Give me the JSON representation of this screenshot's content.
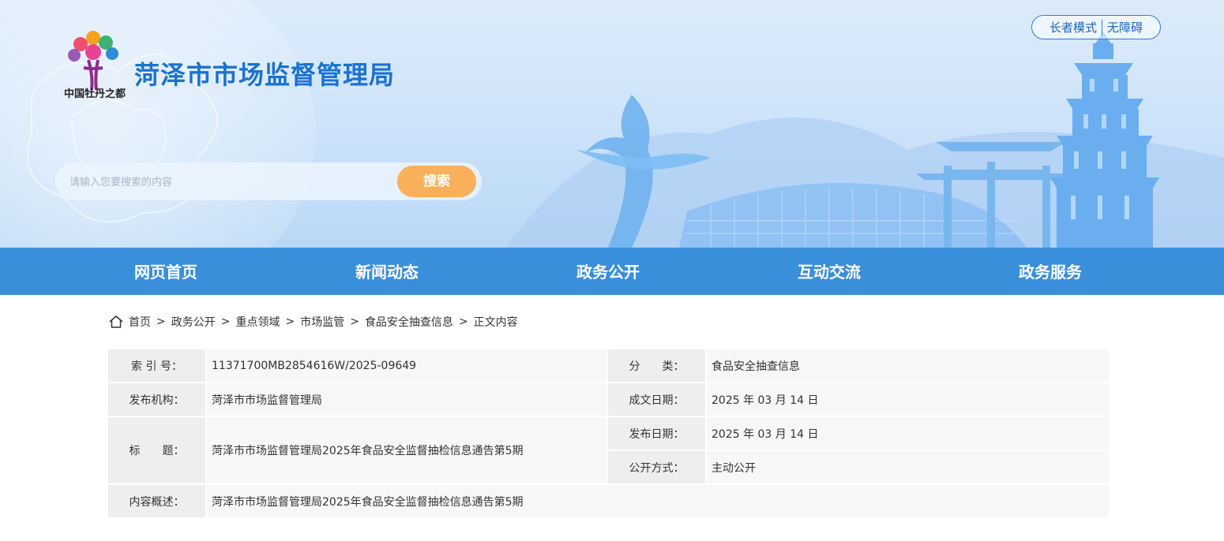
{
  "header": {
    "site_title": "菏泽市市场监督管理局",
    "logo_text": "中国牡丹之都",
    "elder_mode": "长者模式",
    "accessibility": "无障碍",
    "search_placeholder": "请输入您要搜索的内容",
    "search_button": "搜索"
  },
  "nav": [
    "网页首页",
    "新闻动态",
    "政务公开",
    "互动交流",
    "政务服务"
  ],
  "breadcrumb": {
    "items": [
      "首页",
      "政务公开",
      "重点领域",
      "市场监管",
      "食品安全抽查信息",
      "正文内容"
    ],
    "separator": ">"
  },
  "info": {
    "index_label": "索 引 号：",
    "index_value": "11371700MB2854616W/2025-09649",
    "category_label": "分　　类：",
    "category_value": "食品安全抽查信息",
    "publisher_label": "发布机构：",
    "publisher_value": "菏泽市市场监督管理局",
    "written_date_label": "成文日期：",
    "written_date_value": "2025 年 03 月 14 日",
    "title_label": "标　　题：",
    "title_value": "菏泽市市场监督管理局2025年食品安全监督抽检信息通告第5期",
    "publish_date_label": "发布日期：",
    "publish_date_value": "2025 年 03 月 14 日",
    "disclosure_label": "公开方式：",
    "disclosure_value": "主动公开",
    "summary_label": "内容概述：",
    "summary_value": "菏泽市市场监督管理局2025年食品安全监督抽检信息通告第5期"
  },
  "colors": {
    "nav_bg": "#3a8fdb",
    "title_blue": "#1a72d0",
    "search_button": "#f8b05a"
  }
}
